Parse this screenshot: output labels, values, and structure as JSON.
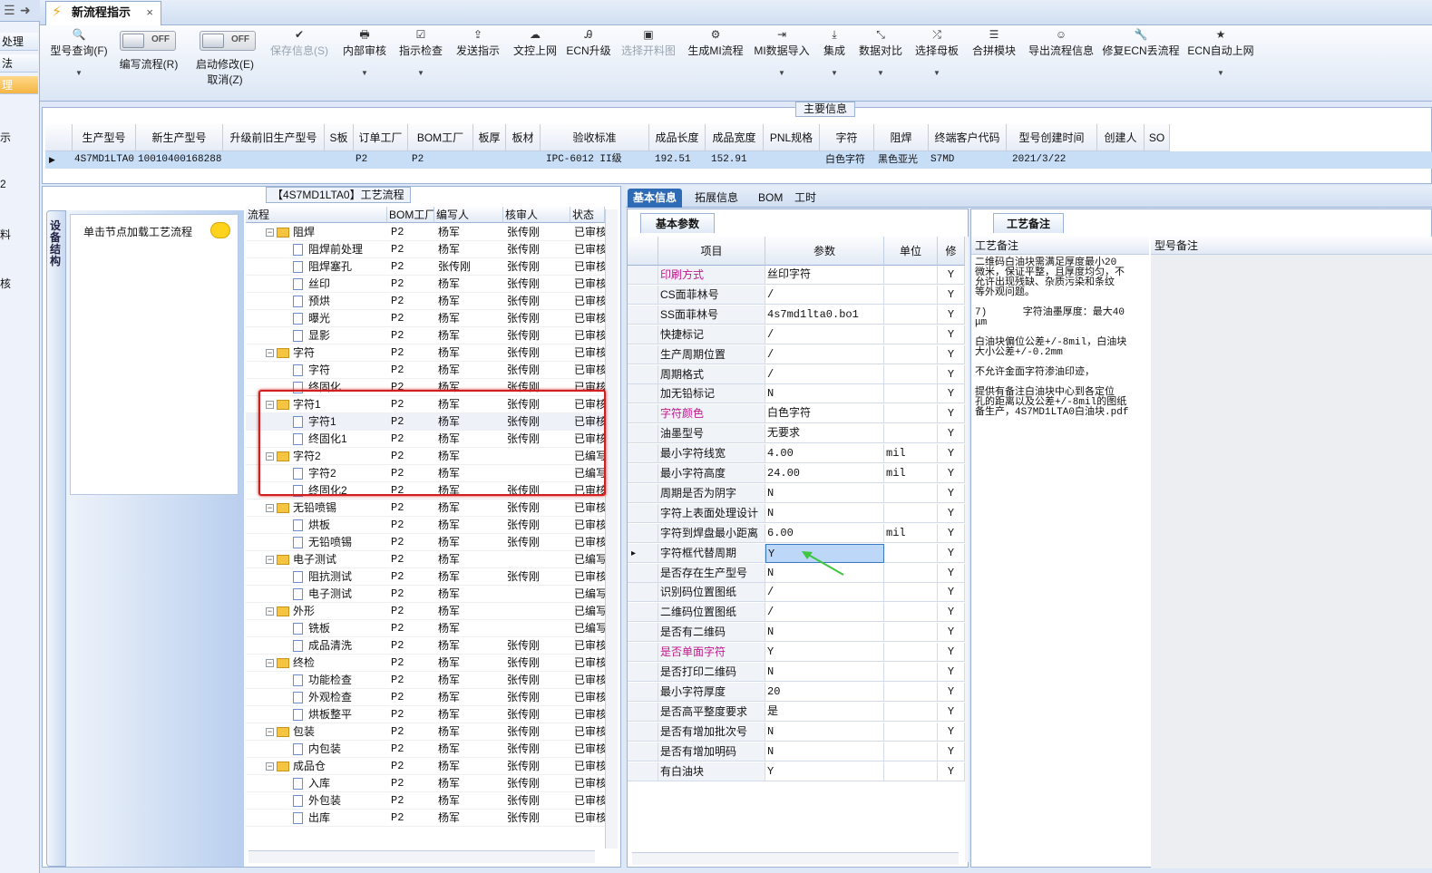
{
  "leftnav": {
    "items": [
      "处理",
      "法",
      "理"
    ],
    "labels": [
      "示",
      "2",
      "料",
      "核"
    ]
  },
  "tab": {
    "title": "新流程指示",
    "close": "×"
  },
  "toolbar": {
    "query": "型号查询(F)",
    "write_toggle": "OFF",
    "write": "编写流程(R)",
    "start_toggle": "OFF",
    "start": "启动修改(E)",
    "cancel": "取消(Z)",
    "buttons": [
      "保存信息(S)",
      "内部审核",
      "指示检查",
      "发送指示",
      "文控上网",
      "ECN升级",
      "选择开料图",
      "生成MI流程",
      "MI数据导入",
      "集成",
      "数据对比",
      "选择母板",
      "合拼模块",
      "导出流程信息",
      "修复ECN丢流程",
      "ECN自动上网"
    ]
  },
  "main_info": {
    "title": "主要信息",
    "headers": [
      "生产型号",
      "新生产型号",
      "升级前旧生产型号",
      "S板",
      "订单工厂",
      "BOM工厂",
      "板厚",
      "板材",
      "验收标准",
      "成品长度",
      "成品宽度",
      "PNL规格",
      "字符",
      "阻焊",
      "终端客户代码",
      "型号创建时间",
      "创建人",
      "SO"
    ],
    "row": {
      "model": "4S7MD1LTA0",
      "new_model": "10010400168288",
      "order_factory": "P2",
      "bom_factory": "P2",
      "standard": "IPC-6012 II级",
      "length": "192.51",
      "width": "152.91",
      "char": "白色字符",
      "solder": "黑色亚光",
      "customer": "S7MD",
      "created": "2021/3/22"
    }
  },
  "process": {
    "title": "【4S7MD1LTA0】工艺流程",
    "vertical_tab": "设备结构",
    "node_hint": "单击节点加载工艺流程",
    "columns": [
      "流程",
      "BOM工厂",
      "编写人",
      "核审人",
      "状态"
    ],
    "rows": [
      {
        "level": 0,
        "name": "阻焊",
        "bom": "P2",
        "writer": "杨军",
        "checker": "张传刚",
        "status": "已审核"
      },
      {
        "level": 1,
        "name": "阻焊前处理",
        "bom": "P2",
        "writer": "杨军",
        "checker": "张传刚",
        "status": "已审核"
      },
      {
        "level": 1,
        "name": "阻焊塞孔",
        "bom": "P2",
        "writer": "张传刚",
        "checker": "张传刚",
        "status": "已审核"
      },
      {
        "level": 1,
        "name": "丝印",
        "bom": "P2",
        "writer": "杨军",
        "checker": "张传刚",
        "status": "已审核"
      },
      {
        "level": 1,
        "name": "预烘",
        "bom": "P2",
        "writer": "杨军",
        "checker": "张传刚",
        "status": "已审核"
      },
      {
        "level": 1,
        "name": "曝光",
        "bom": "P2",
        "writer": "杨军",
        "checker": "张传刚",
        "status": "已审核"
      },
      {
        "level": 1,
        "name": "显影",
        "bom": "P2",
        "writer": "杨军",
        "checker": "张传刚",
        "status": "已审核"
      },
      {
        "level": 0,
        "name": "字符",
        "bom": "P2",
        "writer": "杨军",
        "checker": "张传刚",
        "status": "已审核"
      },
      {
        "level": 1,
        "name": "字符",
        "bom": "P2",
        "writer": "杨军",
        "checker": "张传刚",
        "status": "已审核"
      },
      {
        "level": 1,
        "name": "终固化",
        "bom": "P2",
        "writer": "杨军",
        "checker": "张传刚",
        "status": "已审核"
      },
      {
        "level": 0,
        "name": "字符1",
        "bom": "P2",
        "writer": "杨军",
        "checker": "张传刚",
        "status": "已审核"
      },
      {
        "level": 1,
        "name": "字符1",
        "bom": "P2",
        "writer": "杨军",
        "checker": "张传刚",
        "status": "已审核"
      },
      {
        "level": 1,
        "name": "终固化1",
        "bom": "P2",
        "writer": "杨军",
        "checker": "张传刚",
        "status": "已审核"
      },
      {
        "level": 0,
        "name": "字符2",
        "bom": "P2",
        "writer": "杨军",
        "checker": "",
        "status": "已编写"
      },
      {
        "level": 1,
        "name": "字符2",
        "bom": "P2",
        "writer": "杨军",
        "checker": "",
        "status": "已编写"
      },
      {
        "level": 1,
        "name": "终固化2",
        "bom": "P2",
        "writer": "杨军",
        "checker": "张传刚",
        "status": "已审核"
      },
      {
        "level": 0,
        "name": "无铅喷锡",
        "bom": "P2",
        "writer": "杨军",
        "checker": "张传刚",
        "status": "已审核"
      },
      {
        "level": 1,
        "name": "烘板",
        "bom": "P2",
        "writer": "杨军",
        "checker": "张传刚",
        "status": "已审核"
      },
      {
        "level": 1,
        "name": "无铅喷锡",
        "bom": "P2",
        "writer": "杨军",
        "checker": "张传刚",
        "status": "已审核"
      },
      {
        "level": 0,
        "name": "电子测试",
        "bom": "P2",
        "writer": "杨军",
        "checker": "",
        "status": "已编写"
      },
      {
        "level": 1,
        "name": "阻抗测试",
        "bom": "P2",
        "writer": "杨军",
        "checker": "张传刚",
        "status": "已审核"
      },
      {
        "level": 1,
        "name": "电子测试",
        "bom": "P2",
        "writer": "杨军",
        "checker": "",
        "status": "已编写"
      },
      {
        "level": 0,
        "name": "外形",
        "bom": "P2",
        "writer": "杨军",
        "checker": "",
        "status": "已编写"
      },
      {
        "level": 1,
        "name": "铣板",
        "bom": "P2",
        "writer": "杨军",
        "checker": "",
        "status": "已编写"
      },
      {
        "level": 1,
        "name": "成品清洗",
        "bom": "P2",
        "writer": "杨军",
        "checker": "张传刚",
        "status": "已审核"
      },
      {
        "level": 0,
        "name": "终检",
        "bom": "P2",
        "writer": "杨军",
        "checker": "张传刚",
        "status": "已审核"
      },
      {
        "level": 1,
        "name": "功能检查",
        "bom": "P2",
        "writer": "杨军",
        "checker": "张传刚",
        "status": "已审核"
      },
      {
        "level": 1,
        "name": "外观检查",
        "bom": "P2",
        "writer": "杨军",
        "checker": "张传刚",
        "status": "已审核"
      },
      {
        "level": 1,
        "name": "烘板整平",
        "bom": "P2",
        "writer": "杨军",
        "checker": "张传刚",
        "status": "已审核"
      },
      {
        "level": 0,
        "name": "包装",
        "bom": "P2",
        "writer": "杨军",
        "checker": "张传刚",
        "status": "已审核"
      },
      {
        "level": 1,
        "name": "内包装",
        "bom": "P2",
        "writer": "杨军",
        "checker": "张传刚",
        "status": "已审核"
      },
      {
        "level": 0,
        "name": "成品仓",
        "bom": "P2",
        "writer": "杨军",
        "checker": "张传刚",
        "status": "已审核"
      },
      {
        "level": 1,
        "name": "入库",
        "bom": "P2",
        "writer": "杨军",
        "checker": "张传刚",
        "status": "已审核"
      },
      {
        "level": 1,
        "name": "外包装",
        "bom": "P2",
        "writer": "杨军",
        "checker": "张传刚",
        "status": "已审核"
      },
      {
        "level": 1,
        "name": "出库",
        "bom": "P2",
        "writer": "杨军",
        "checker": "张传刚",
        "status": "已审核"
      }
    ]
  },
  "right_tabs": [
    "基本信息",
    "拓展信息",
    "BOM",
    "工时"
  ],
  "basic": {
    "caption": "基本参数",
    "headers": [
      "项目",
      "参数",
      "单位",
      "修"
    ],
    "rows": [
      {
        "item": "印刷方式",
        "value": "丝印字符",
        "unit": "",
        "flag": "Y",
        "pink": true
      },
      {
        "item": "CS面菲林号",
        "value": "/",
        "unit": "",
        "flag": "Y"
      },
      {
        "item": "SS面菲林号",
        "value": "4s7md1lta0.bo1",
        "unit": "",
        "flag": "Y"
      },
      {
        "item": "快捷标记",
        "value": "/",
        "unit": "",
        "flag": "Y"
      },
      {
        "item": "生产周期位置",
        "value": "/",
        "unit": "",
        "flag": "Y"
      },
      {
        "item": "周期格式",
        "value": "/",
        "unit": "",
        "flag": "Y"
      },
      {
        "item": "加无铅标记",
        "value": "N",
        "unit": "",
        "flag": "Y"
      },
      {
        "item": "字符颜色",
        "value": "白色字符",
        "unit": "",
        "flag": "Y",
        "pink": true
      },
      {
        "item": "油墨型号",
        "value": "无要求",
        "unit": "",
        "flag": "Y"
      },
      {
        "item": "最小字符线宽",
        "value": "4.00",
        "unit": "mil",
        "flag": "Y"
      },
      {
        "item": "最小字符高度",
        "value": "24.00",
        "unit": "mil",
        "flag": "Y"
      },
      {
        "item": "周期是否为阴字",
        "value": "N",
        "unit": "",
        "flag": "Y"
      },
      {
        "item": "字符上表面处理设计",
        "value": "N",
        "unit": "",
        "flag": "Y"
      },
      {
        "item": "字符到焊盘最小距离",
        "value": "6.00",
        "unit": "mil",
        "flag": "Y"
      },
      {
        "item": "字符框代替周期",
        "value": "Y",
        "unit": "",
        "flag": "Y",
        "selected": true
      },
      {
        "item": "是否存在生产型号",
        "value": "N",
        "unit": "",
        "flag": "Y"
      },
      {
        "item": "识别码位置图纸",
        "value": "/",
        "unit": "",
        "flag": "Y"
      },
      {
        "item": "二维码位置图纸",
        "value": "/",
        "unit": "",
        "flag": "Y"
      },
      {
        "item": "是否有二维码",
        "value": "N",
        "unit": "",
        "flag": "Y"
      },
      {
        "item": "是否单面字符",
        "value": "Y",
        "unit": "",
        "flag": "Y",
        "pink": true
      },
      {
        "item": "是否打印二维码",
        "value": "N",
        "unit": "",
        "flag": "Y"
      },
      {
        "item": "最小字符厚度",
        "value": "20",
        "unit": "",
        "flag": "Y"
      },
      {
        "item": "是否高平整度要求",
        "value": "是",
        "unit": "",
        "flag": "Y"
      },
      {
        "item": "是否有增加批次号",
        "value": "N",
        "unit": "",
        "flag": "Y"
      },
      {
        "item": "是否有增加明码",
        "value": "N",
        "unit": "",
        "flag": "Y"
      },
      {
        "item": "有白油块",
        "value": "Y",
        "unit": "",
        "flag": "Y"
      }
    ]
  },
  "remarks": {
    "caption": "工艺备注",
    "col1": "工艺备注",
    "col2": "型号备注",
    "text": "二维码白油块需满足厚度最小20\n微米，保证平整，且厚度均匀，不\n允许出现残缺、杂质污染和条纹\n等外观问题。\n\n7)      字符油墨厚度：最大40\nμm\n\n白油块偏位公差+/-8mil，白油块\n大小公差+/-0.2mm\n\n不允许金面字符渗油印迹，\n\n提供有备注白油块中心到各定位\n孔的距离以及公差+/-8mil的图纸\n备生产，4S7MD1LTA0白油块.pdf"
  }
}
